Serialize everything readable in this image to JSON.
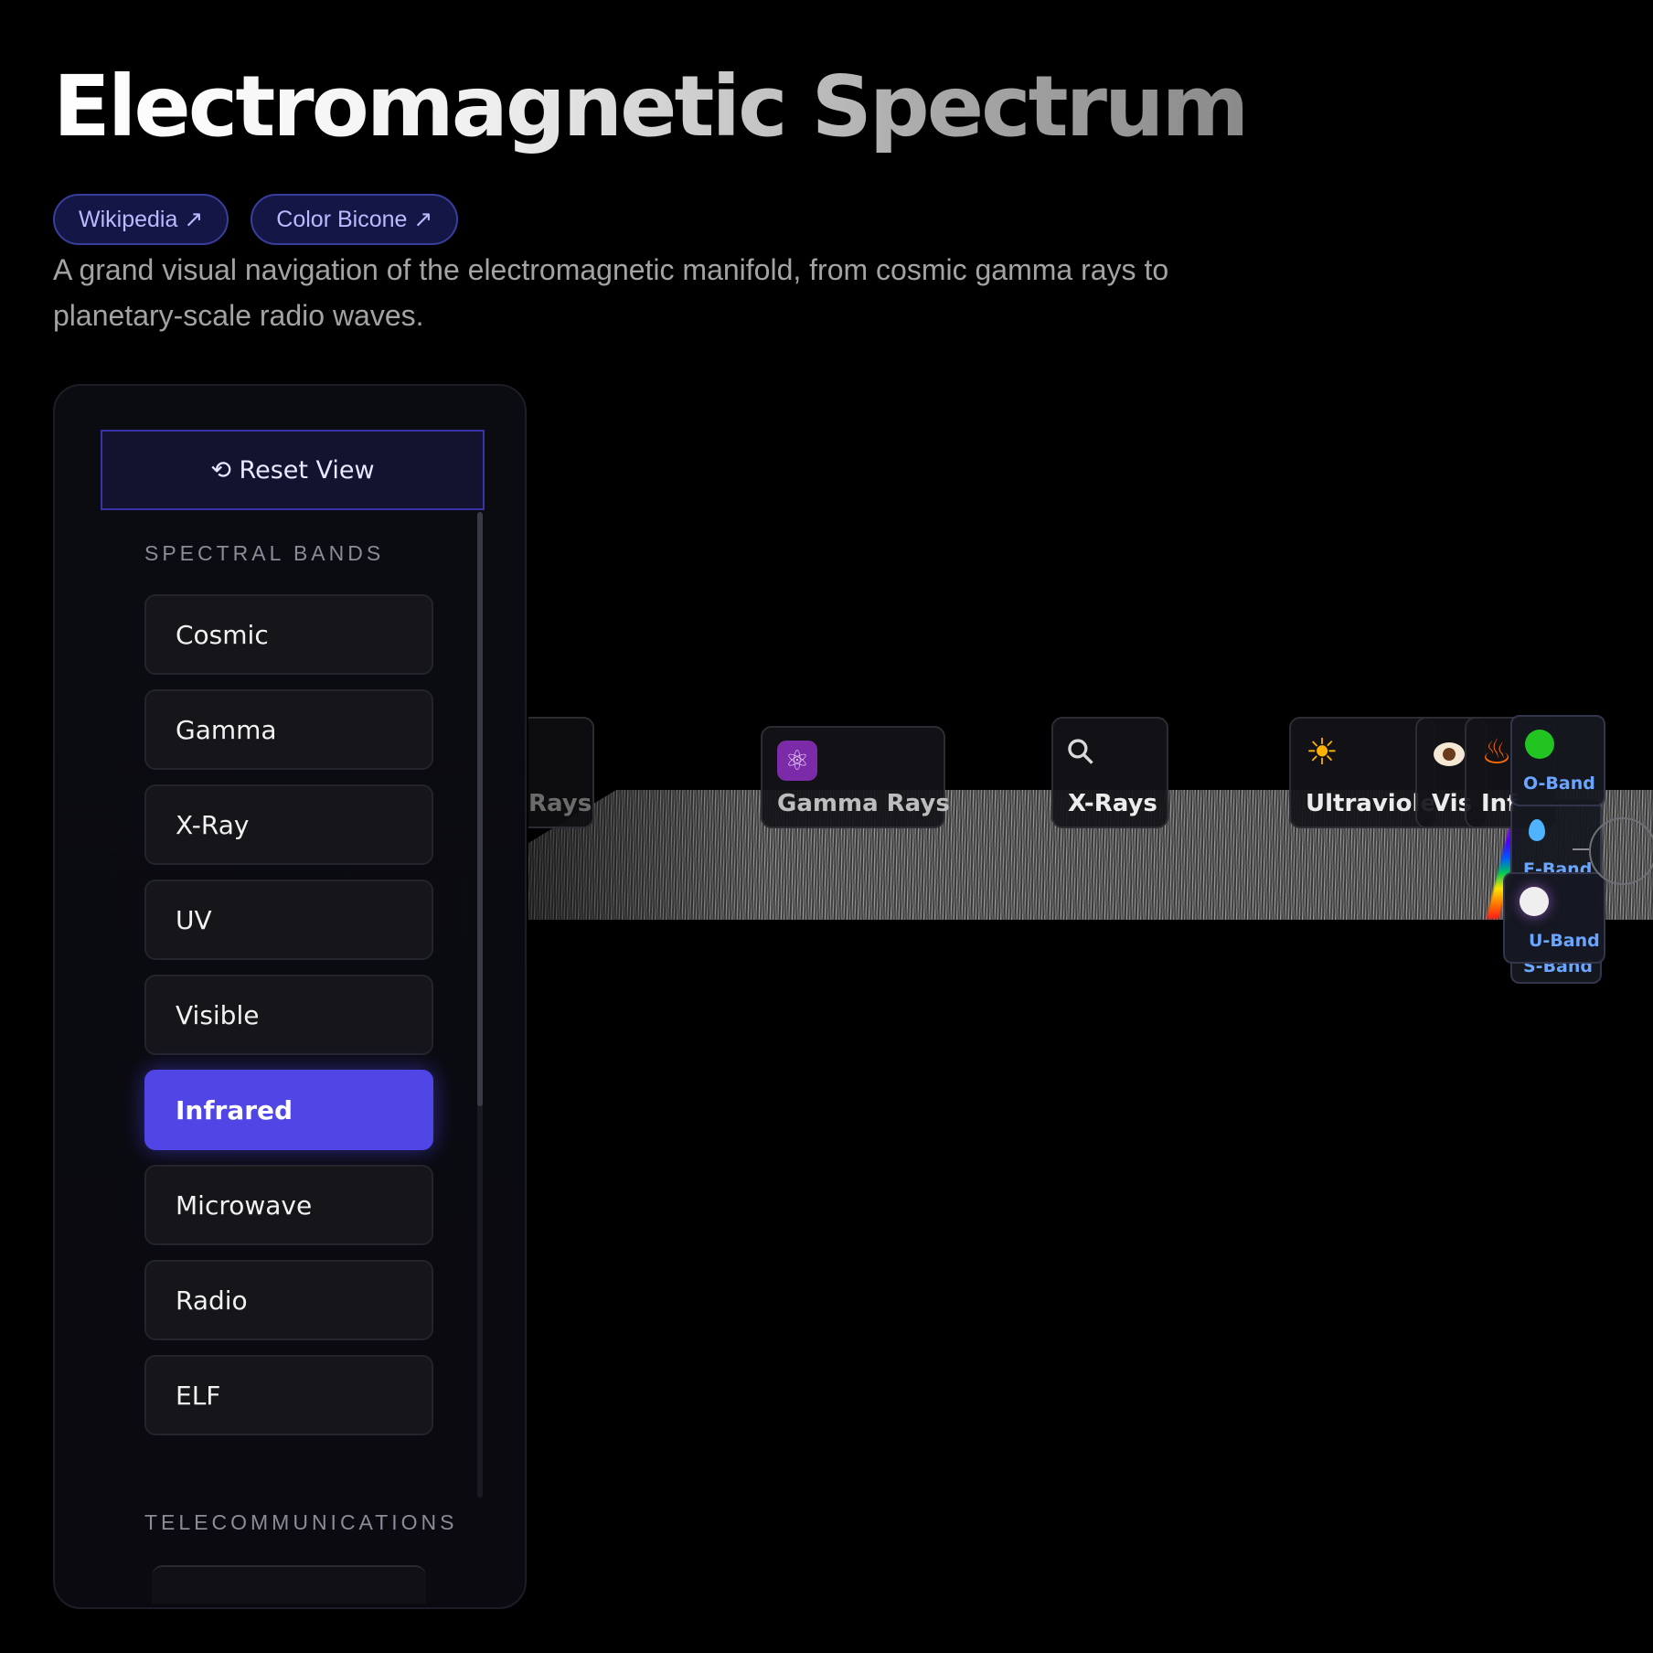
{
  "header": {
    "title": "Electromagnetic Spectrum",
    "links": [
      {
        "label": "Wikipedia ↗"
      },
      {
        "label": "Color Bicone ↗"
      }
    ],
    "description": "A grand visual navigation of the electromagnetic manifold, from cosmic gamma rays to planetary-scale radio waves."
  },
  "sidebar": {
    "reset_label": "⟲ Reset View",
    "spectral_section": "SPECTRAL BANDS",
    "bands": [
      {
        "label": "Cosmic",
        "active": false
      },
      {
        "label": "Gamma",
        "active": false
      },
      {
        "label": "X-Ray",
        "active": false
      },
      {
        "label": "UV",
        "active": false
      },
      {
        "label": "Visible",
        "active": false
      },
      {
        "label": "Infrared",
        "active": true
      },
      {
        "label": "Microwave",
        "active": false
      },
      {
        "label": "Radio",
        "active": false
      },
      {
        "label": "ELF",
        "active": false
      }
    ],
    "telecom_section": "TELECOMMUNICATIONS"
  },
  "visualization": {
    "cards": [
      {
        "label": "Rays",
        "icon": ""
      },
      {
        "label": "Gamma Rays",
        "icon": "atom-icon"
      },
      {
        "label": "X-Rays",
        "icon": "bone-icon"
      },
      {
        "label": "Ultraviole",
        "icon": "sun-icon"
      },
      {
        "label": "Vis",
        "icon": "eye-icon"
      },
      {
        "label": "Inf",
        "icon": "fire-icon"
      }
    ],
    "telecom_cards": [
      {
        "label": "O-Band",
        "icon": "green-circle-icon"
      },
      {
        "label": "E-Band",
        "icon": "droplet-icon"
      },
      {
        "label": "U-Band",
        "icon": "white-circle-icon"
      },
      {
        "label": "S-Band",
        "icon": ""
      }
    ],
    "colors": {
      "accent": "#4f46e5",
      "telecom_label": "#6aa6ff"
    }
  }
}
